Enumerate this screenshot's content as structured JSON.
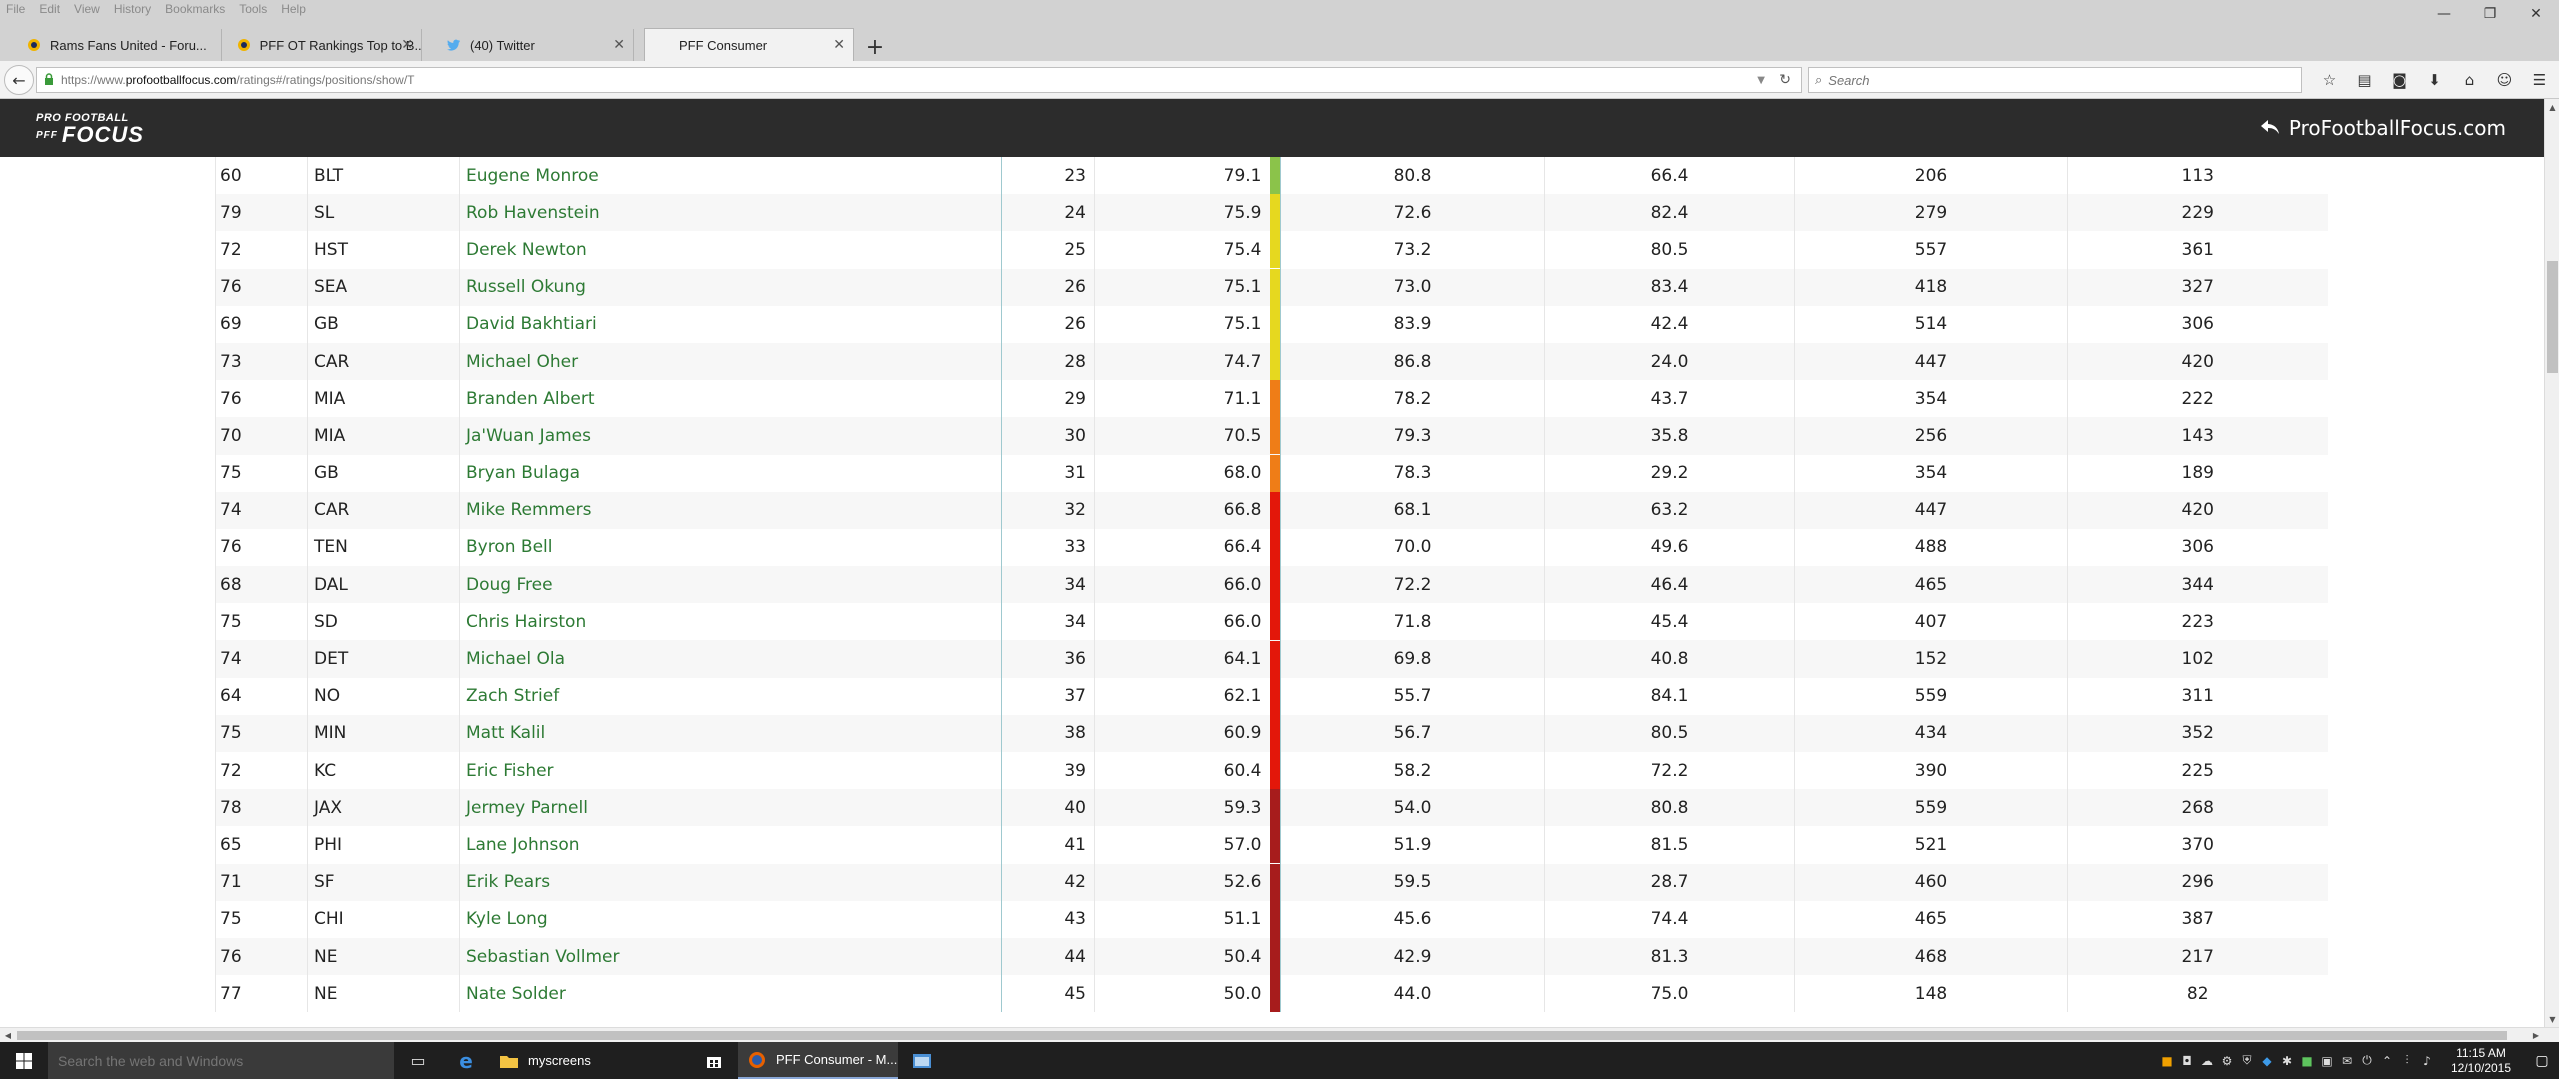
{
  "menubar": {
    "items": [
      "File",
      "Edit",
      "View",
      "History",
      "Bookmarks",
      "Tools",
      "Help"
    ]
  },
  "window_controls": {
    "minimize": "—",
    "restore": "❐",
    "close": "✕"
  },
  "tabs": [
    {
      "title": "Rams Fans United - Foru...",
      "icon": "rams-favicon-icon"
    },
    {
      "title": "PFF OT Rankings Top to B...",
      "icon": "rams-favicon-icon"
    },
    {
      "title": "(40) Twitter",
      "icon": "twitter-bird-icon"
    },
    {
      "title": "PFF Consumer",
      "icon": "blank-page-icon"
    }
  ],
  "new_tab_glyph": "+",
  "tab_close_glyph": "✕",
  "navbar": {
    "back_glyph": "←",
    "url_prefix": "https://www.",
    "url_domain": "profootballfocus.com",
    "url_path": "/ratings#/ratings/positions/show/T",
    "search_placeholder": "Search"
  },
  "toolbar_icons": [
    "bookmark-star-icon",
    "reading-list-icon",
    "pocket-icon",
    "download-icon",
    "home-icon",
    "chat-icon",
    "menu-icon"
  ],
  "header": {
    "logo_top": "PRO FOOTBALL",
    "logo_bottom": "FOCUS",
    "logo_badge": "PFF",
    "site_link": "ProFootballFocus.com"
  },
  "colors": {
    "header_bg": "#2c2c2c",
    "name_link": "#2d7a34",
    "grade_green": "#8bc34a",
    "grade_yellow": "#e6d81f",
    "grade_orange": "#ef7d17",
    "grade_red": "#e3170a",
    "grade_darkred": "#a71c1c"
  },
  "table": {
    "rows": [
      {
        "age": "60",
        "team": "BLT",
        "name": "Eugene Monroe",
        "rank": "23",
        "grade": "79.1",
        "tier": "green",
        "pass_block": "80.8",
        "run_block": "66.4",
        "pass_snaps": "206",
        "run_snaps": "113"
      },
      {
        "age": "79",
        "team": "SL",
        "name": "Rob Havenstein",
        "rank": "24",
        "grade": "75.9",
        "tier": "yellow",
        "pass_block": "72.6",
        "run_block": "82.4",
        "pass_snaps": "279",
        "run_snaps": "229"
      },
      {
        "age": "72",
        "team": "HST",
        "name": "Derek Newton",
        "rank": "25",
        "grade": "75.4",
        "tier": "yellow",
        "pass_block": "73.2",
        "run_block": "80.5",
        "pass_snaps": "557",
        "run_snaps": "361"
      },
      {
        "age": "76",
        "team": "SEA",
        "name": "Russell Okung",
        "rank": "26",
        "grade": "75.1",
        "tier": "yellow",
        "pass_block": "73.0",
        "run_block": "83.4",
        "pass_snaps": "418",
        "run_snaps": "327"
      },
      {
        "age": "69",
        "team": "GB",
        "name": "David Bakhtiari",
        "rank": "26",
        "grade": "75.1",
        "tier": "yellow",
        "pass_block": "83.9",
        "run_block": "42.4",
        "pass_snaps": "514",
        "run_snaps": "306"
      },
      {
        "age": "73",
        "team": "CAR",
        "name": "Michael Oher",
        "rank": "28",
        "grade": "74.7",
        "tier": "yellow",
        "pass_block": "86.8",
        "run_block": "24.0",
        "pass_snaps": "447",
        "run_snaps": "420"
      },
      {
        "age": "76",
        "team": "MIA",
        "name": "Branden Albert",
        "rank": "29",
        "grade": "71.1",
        "tier": "orange",
        "pass_block": "78.2",
        "run_block": "43.7",
        "pass_snaps": "354",
        "run_snaps": "222"
      },
      {
        "age": "70",
        "team": "MIA",
        "name": "Ja'Wuan James",
        "rank": "30",
        "grade": "70.5",
        "tier": "orange",
        "pass_block": "79.3",
        "run_block": "35.8",
        "pass_snaps": "256",
        "run_snaps": "143"
      },
      {
        "age": "75",
        "team": "GB",
        "name": "Bryan Bulaga",
        "rank": "31",
        "grade": "68.0",
        "tier": "orange",
        "pass_block": "78.3",
        "run_block": "29.2",
        "pass_snaps": "354",
        "run_snaps": "189"
      },
      {
        "age": "74",
        "team": "CAR",
        "name": "Mike Remmers",
        "rank": "32",
        "grade": "66.8",
        "tier": "red",
        "pass_block": "68.1",
        "run_block": "63.2",
        "pass_snaps": "447",
        "run_snaps": "420"
      },
      {
        "age": "76",
        "team": "TEN",
        "name": "Byron Bell",
        "rank": "33",
        "grade": "66.4",
        "tier": "red",
        "pass_block": "70.0",
        "run_block": "49.6",
        "pass_snaps": "488",
        "run_snaps": "306"
      },
      {
        "age": "68",
        "team": "DAL",
        "name": "Doug Free",
        "rank": "34",
        "grade": "66.0",
        "tier": "red",
        "pass_block": "72.2",
        "run_block": "46.4",
        "pass_snaps": "465",
        "run_snaps": "344"
      },
      {
        "age": "75",
        "team": "SD",
        "name": "Chris Hairston",
        "rank": "34",
        "grade": "66.0",
        "tier": "red",
        "pass_block": "71.8",
        "run_block": "45.4",
        "pass_snaps": "407",
        "run_snaps": "223"
      },
      {
        "age": "74",
        "team": "DET",
        "name": "Michael Ola",
        "rank": "36",
        "grade": "64.1",
        "tier": "red",
        "pass_block": "69.8",
        "run_block": "40.8",
        "pass_snaps": "152",
        "run_snaps": "102"
      },
      {
        "age": "64",
        "team": "NO",
        "name": "Zach Strief",
        "rank": "37",
        "grade": "62.1",
        "tier": "red",
        "pass_block": "55.7",
        "run_block": "84.1",
        "pass_snaps": "559",
        "run_snaps": "311"
      },
      {
        "age": "75",
        "team": "MIN",
        "name": "Matt Kalil",
        "rank": "38",
        "grade": "60.9",
        "tier": "red",
        "pass_block": "56.7",
        "run_block": "80.5",
        "pass_snaps": "434",
        "run_snaps": "352"
      },
      {
        "age": "72",
        "team": "KC",
        "name": "Eric Fisher",
        "rank": "39",
        "grade": "60.4",
        "tier": "red",
        "pass_block": "58.2",
        "run_block": "72.2",
        "pass_snaps": "390",
        "run_snaps": "225"
      },
      {
        "age": "78",
        "team": "JAX",
        "name": "Jermey Parnell",
        "rank": "40",
        "grade": "59.3",
        "tier": "darkred",
        "pass_block": "54.0",
        "run_block": "80.8",
        "pass_snaps": "559",
        "run_snaps": "268"
      },
      {
        "age": "65",
        "team": "PHI",
        "name": "Lane Johnson",
        "rank": "41",
        "grade": "57.0",
        "tier": "darkred",
        "pass_block": "51.9",
        "run_block": "81.5",
        "pass_snaps": "521",
        "run_snaps": "370"
      },
      {
        "age": "71",
        "team": "SF",
        "name": "Erik Pears",
        "rank": "42",
        "grade": "52.6",
        "tier": "darkred",
        "pass_block": "59.5",
        "run_block": "28.7",
        "pass_snaps": "460",
        "run_snaps": "296"
      },
      {
        "age": "75",
        "team": "CHI",
        "name": "Kyle Long",
        "rank": "43",
        "grade": "51.1",
        "tier": "darkred",
        "pass_block": "45.6",
        "run_block": "74.4",
        "pass_snaps": "465",
        "run_snaps": "387"
      },
      {
        "age": "76",
        "team": "NE",
        "name": "Sebastian Vollmer",
        "rank": "44",
        "grade": "50.4",
        "tier": "darkred",
        "pass_block": "42.9",
        "run_block": "81.3",
        "pass_snaps": "468",
        "run_snaps": "217"
      },
      {
        "age": "77",
        "team": "NE",
        "name": "Nate Solder",
        "rank": "45",
        "grade": "50.0",
        "tier": "darkred",
        "pass_block": "44.0",
        "run_block": "75.0",
        "pass_snaps": "148",
        "run_snaps": "82"
      }
    ]
  },
  "scrollbars": {
    "up": "▲",
    "down": "▼",
    "left": "◀",
    "right": "▶"
  },
  "taskbar": {
    "start_icon": "windows-logo-icon",
    "search_placeholder": "Search the web and Windows",
    "task_view_icon": "task-view-icon",
    "edge_icon": "edge-browser-icon",
    "explorer_label": "myscreens",
    "store_icon": "store-icon",
    "firefox_label": "PFF Consumer - M...",
    "clock_time": "11:15 AM",
    "clock_date": "12/10/2015"
  }
}
